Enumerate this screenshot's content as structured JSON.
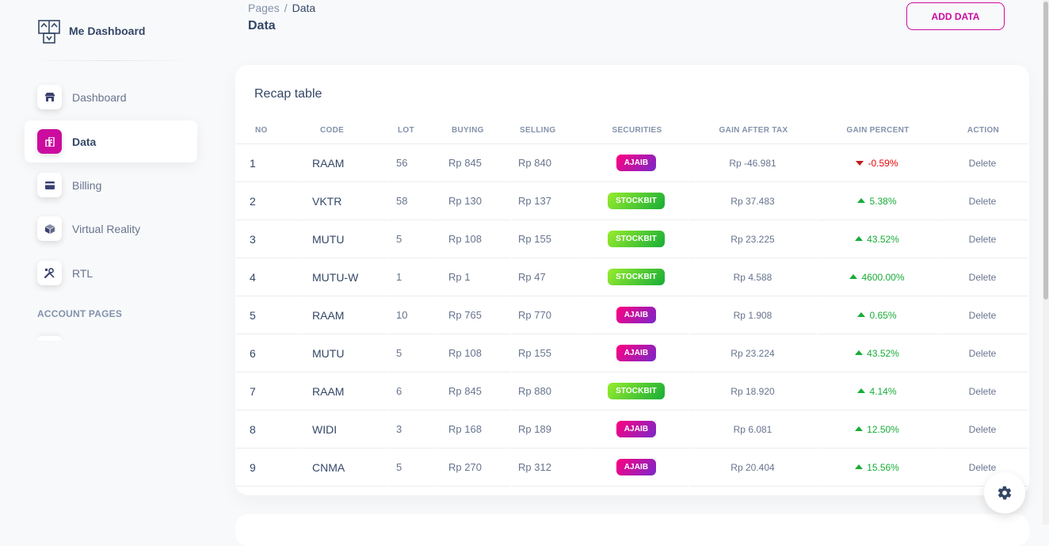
{
  "brand": {
    "name": "Me Dashboard",
    "icon": "cube-logo-icon"
  },
  "sidebar": {
    "items": [
      {
        "label": "Dashboard",
        "icon": "shop-icon"
      },
      {
        "label": "Data",
        "icon": "office-icon",
        "active": true
      },
      {
        "label": "Billing",
        "icon": "credit-card-icon"
      },
      {
        "label": "Virtual Reality",
        "icon": "box-3d-icon"
      },
      {
        "label": "RTL",
        "icon": "settings-tools-icon"
      }
    ],
    "section_title": "ACCOUNT PAGES"
  },
  "header": {
    "breadcrumb": {
      "root": "Pages",
      "separator": "/",
      "current": "Data"
    },
    "title": "Data",
    "add_button": "ADD DATA"
  },
  "card": {
    "title": "Recap table",
    "columns": [
      "NO",
      "CODE",
      "LOT",
      "BUYING",
      "SELLING",
      "SECURITIES",
      "GAIN AFTER TAX",
      "GAIN PERCENT",
      "ACTION"
    ],
    "rows": [
      {
        "no": "1",
        "code": "RAAM",
        "lot": "56",
        "buying": "Rp 845",
        "selling": "Rp 840",
        "securities": "AJAIB",
        "gain": "Rp -46.981",
        "percent": "-0.59%",
        "trend": "down",
        "action": "Delete"
      },
      {
        "no": "2",
        "code": "VKTR",
        "lot": "58",
        "buying": "Rp 130",
        "selling": "Rp 137",
        "securities": "STOCKBIT",
        "gain": "Rp 37.483",
        "percent": "5.38%",
        "trend": "up",
        "action": "Delete"
      },
      {
        "no": "3",
        "code": "MUTU",
        "lot": "5",
        "buying": "Rp 108",
        "selling": "Rp 155",
        "securities": "STOCKBIT",
        "gain": "Rp 23.225",
        "percent": "43.52%",
        "trend": "up",
        "action": "Delete"
      },
      {
        "no": "4",
        "code": "MUTU-W",
        "lot": "1",
        "buying": "Rp 1",
        "selling": "Rp 47",
        "securities": "STOCKBIT",
        "gain": "Rp 4.588",
        "percent": "4600.00%",
        "trend": "up",
        "action": "Delete"
      },
      {
        "no": "5",
        "code": "RAAM",
        "lot": "10",
        "buying": "Rp 765",
        "selling": "Rp 770",
        "securities": "AJAIB",
        "gain": "Rp 1.908",
        "percent": "0.65%",
        "trend": "up",
        "action": "Delete"
      },
      {
        "no": "6",
        "code": "MUTU",
        "lot": "5",
        "buying": "Rp 108",
        "selling": "Rp 155",
        "securities": "AJAIB",
        "gain": "Rp 23.224",
        "percent": "43.52%",
        "trend": "up",
        "action": "Delete"
      },
      {
        "no": "7",
        "code": "RAAM",
        "lot": "6",
        "buying": "Rp 845",
        "selling": "Rp 880",
        "securities": "STOCKBIT",
        "gain": "Rp 18.920",
        "percent": "4.14%",
        "trend": "up",
        "action": "Delete"
      },
      {
        "no": "8",
        "code": "WIDI",
        "lot": "3",
        "buying": "Rp 168",
        "selling": "Rp 189",
        "securities": "AJAIB",
        "gain": "Rp 6.081",
        "percent": "12.50%",
        "trend": "up",
        "action": "Delete"
      },
      {
        "no": "9",
        "code": "CNMA",
        "lot": "5",
        "buying": "Rp 270",
        "selling": "Rp 312",
        "securities": "AJAIB",
        "gain": "Rp 20.404",
        "percent": "15.56%",
        "trend": "up",
        "action": "Delete"
      }
    ]
  },
  "colors": {
    "accent": "#cb0c9f",
    "up": "#17ad37",
    "down": "#ea0606",
    "text": "#344767",
    "muted": "#67748e"
  },
  "fab": {
    "icon": "gear-icon"
  }
}
